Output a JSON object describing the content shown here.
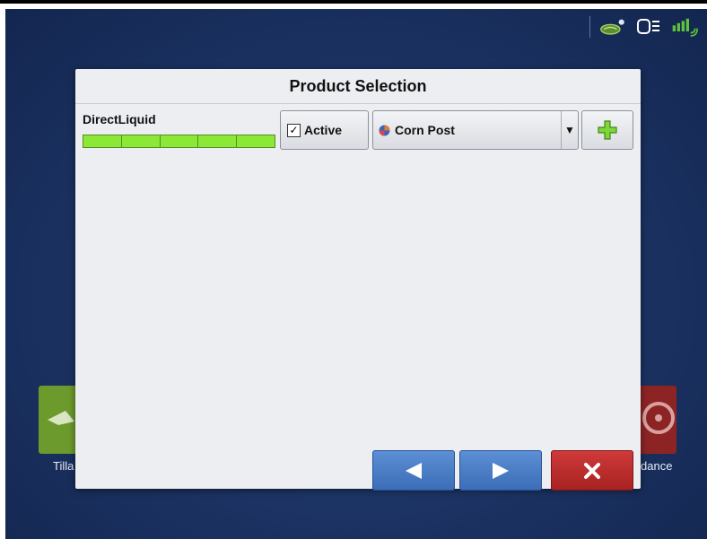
{
  "dialog": {
    "title": "Product Selection"
  },
  "product": {
    "name": "DirectLiquid",
    "sections": 5,
    "active_label": "Active",
    "active_checked": true,
    "selected_product": "Corn Post",
    "add_icon": "plus-icon"
  },
  "background_tiles": {
    "left_label": "Tilla",
    "right_label": "dance"
  },
  "nav": {
    "prev_icon": "arrow-left-icon",
    "next_icon": "arrow-right-icon",
    "close_icon": "close-icon"
  },
  "colors": {
    "section_green": "#8be836",
    "nav_blue": "#4a7cc5",
    "close_red": "#b92b2b",
    "add_green": "#7fd63a"
  }
}
